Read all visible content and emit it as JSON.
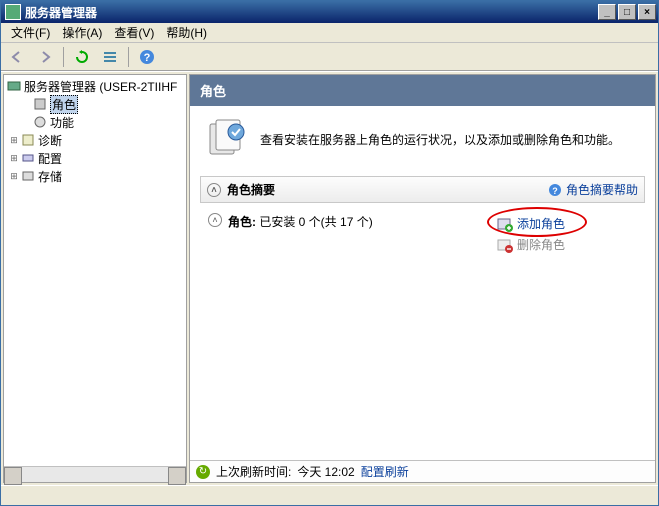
{
  "window": {
    "title": "服务器管理器"
  },
  "menu": {
    "file": "文件(F)",
    "action": "操作(A)",
    "view": "查看(V)",
    "help": "帮助(H)"
  },
  "tree": {
    "root": "服务器管理器 (USER-2TIIHF",
    "roles": "角色",
    "features": "功能",
    "diagnostics": "诊断",
    "configuration": "配置",
    "storage": "存储"
  },
  "content": {
    "header": "角色",
    "description": "查看安装在服务器上角色的运行状况，以及添加或删除角色和功能。",
    "summary_title": "角色摘要",
    "help_link": "角色摘要帮助",
    "roles_label": "角色:",
    "roles_status": "已安装 0 个(共 17 个)",
    "add_roles": "添加角色",
    "remove_roles": "删除角色"
  },
  "status": {
    "refresh_prefix": "上次刷新时间:",
    "refresh_time": "今天 12:02",
    "config_refresh": "配置刷新"
  },
  "winbtns": {
    "min": "_",
    "max": "□",
    "close": "×"
  }
}
